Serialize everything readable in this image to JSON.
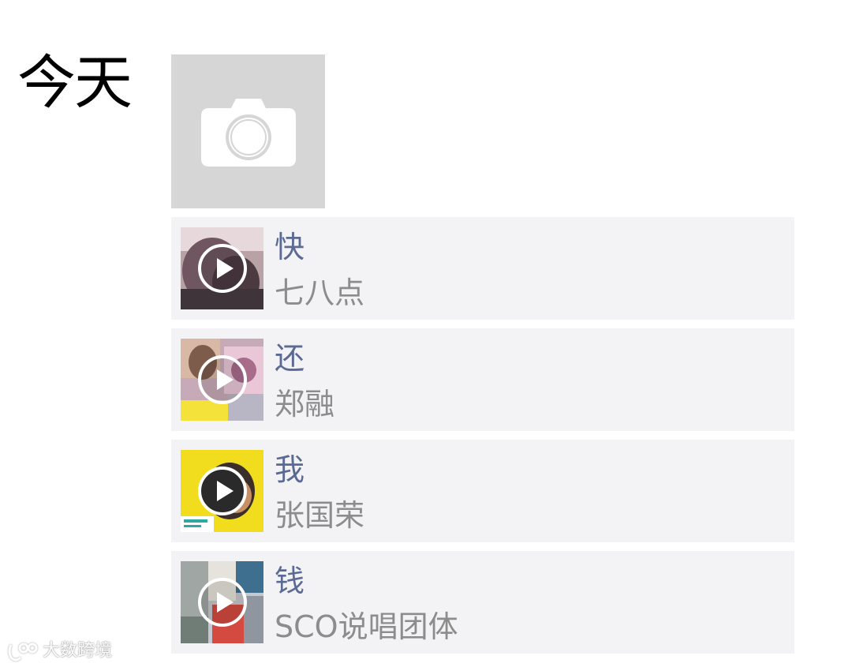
{
  "moments": {
    "day_label": "今天",
    "camera": {
      "icon": "camera-icon"
    },
    "tracks": [
      {
        "title": "快",
        "artist": "七八点",
        "cover_colors": [
          "#b9a2a6",
          "#4b3b41",
          "#e7d8dc"
        ]
      },
      {
        "title": "还",
        "artist": "郑融",
        "cover_colors": [
          "#c7aab7",
          "#7d5c4c",
          "#e9c7d6",
          "#f4e23b"
        ]
      },
      {
        "title": "我",
        "artist": "张国荣",
        "cover_colors": [
          "#f1dc1d",
          "#3a2f2a",
          "#2fa8a1"
        ]
      },
      {
        "title": "钱",
        "artist": "SCO说唱团体",
        "cover_colors": [
          "#c6c8cf",
          "#d44a40",
          "#3f6f8f"
        ]
      }
    ]
  },
  "watermark": {
    "text": "大数跨境",
    "icon": "logo-icon"
  },
  "colors": {
    "title": "#5a6a93",
    "artist": "#8c8c8c",
    "card_bg": "#f3f3f5",
    "camera_bg": "#d6d6d6"
  }
}
